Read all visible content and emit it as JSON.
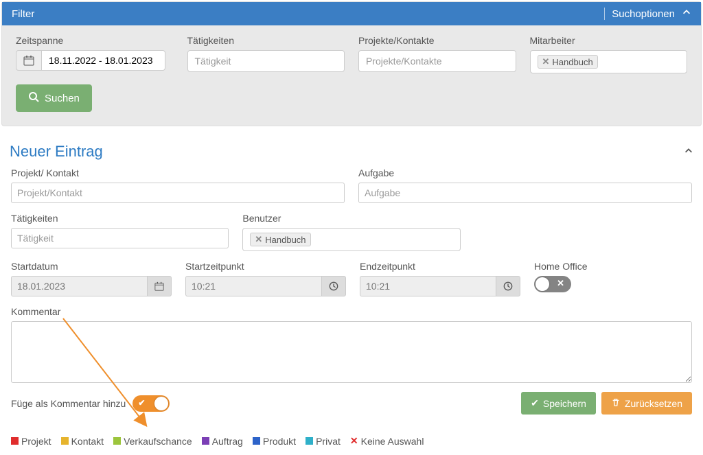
{
  "filter": {
    "title": "Filter",
    "search_options": "Suchoptionen",
    "timespan": {
      "label": "Zeitspanne",
      "value": "18.11.2022 - 18.01.2023"
    },
    "activity": {
      "label": "Tätigkeiten",
      "placeholder": "Tätigkeit"
    },
    "projects": {
      "label": "Projekte/Kontakte",
      "placeholder": "Projekte/Kontakte"
    },
    "employees": {
      "label": "Mitarbeiter",
      "chip": "Handbuch"
    },
    "search_btn": "Suchen"
  },
  "entry": {
    "title": "Neuer Eintrag",
    "project": {
      "label": "Projekt/ Kontakt",
      "placeholder": "Projekt/Kontakt"
    },
    "task": {
      "label": "Aufgabe",
      "placeholder": "Aufgabe"
    },
    "activity": {
      "label": "Tätigkeiten",
      "placeholder": "Tätigkeit"
    },
    "user": {
      "label": "Benutzer",
      "chip": "Handbuch"
    },
    "startdate": {
      "label": "Startdatum",
      "value": "18.01.2023"
    },
    "starttime": {
      "label": "Startzeitpunkt",
      "value": "10:21"
    },
    "endtime": {
      "label": "Endzeitpunkt",
      "value": "10:21"
    },
    "homeoffice": {
      "label": "Home Office"
    },
    "comment": {
      "label": "Kommentar"
    },
    "add_comment": "Füge als Kommentar hinzu",
    "save": "Speichern",
    "reset": "Zurücksetzen"
  },
  "legend": {
    "items": [
      {
        "label": "Projekt",
        "color": "#e02d2d"
      },
      {
        "label": "Kontakt",
        "color": "#e6b42d"
      },
      {
        "label": "Verkaufschance",
        "color": "#9cc53c"
      },
      {
        "label": "Auftrag",
        "color": "#7b3fb5"
      },
      {
        "label": "Produkt",
        "color": "#2d63c9"
      },
      {
        "label": "Privat",
        "color": "#2fb0c9"
      },
      {
        "label": "Keine Auswahl",
        "color": "x"
      }
    ]
  }
}
